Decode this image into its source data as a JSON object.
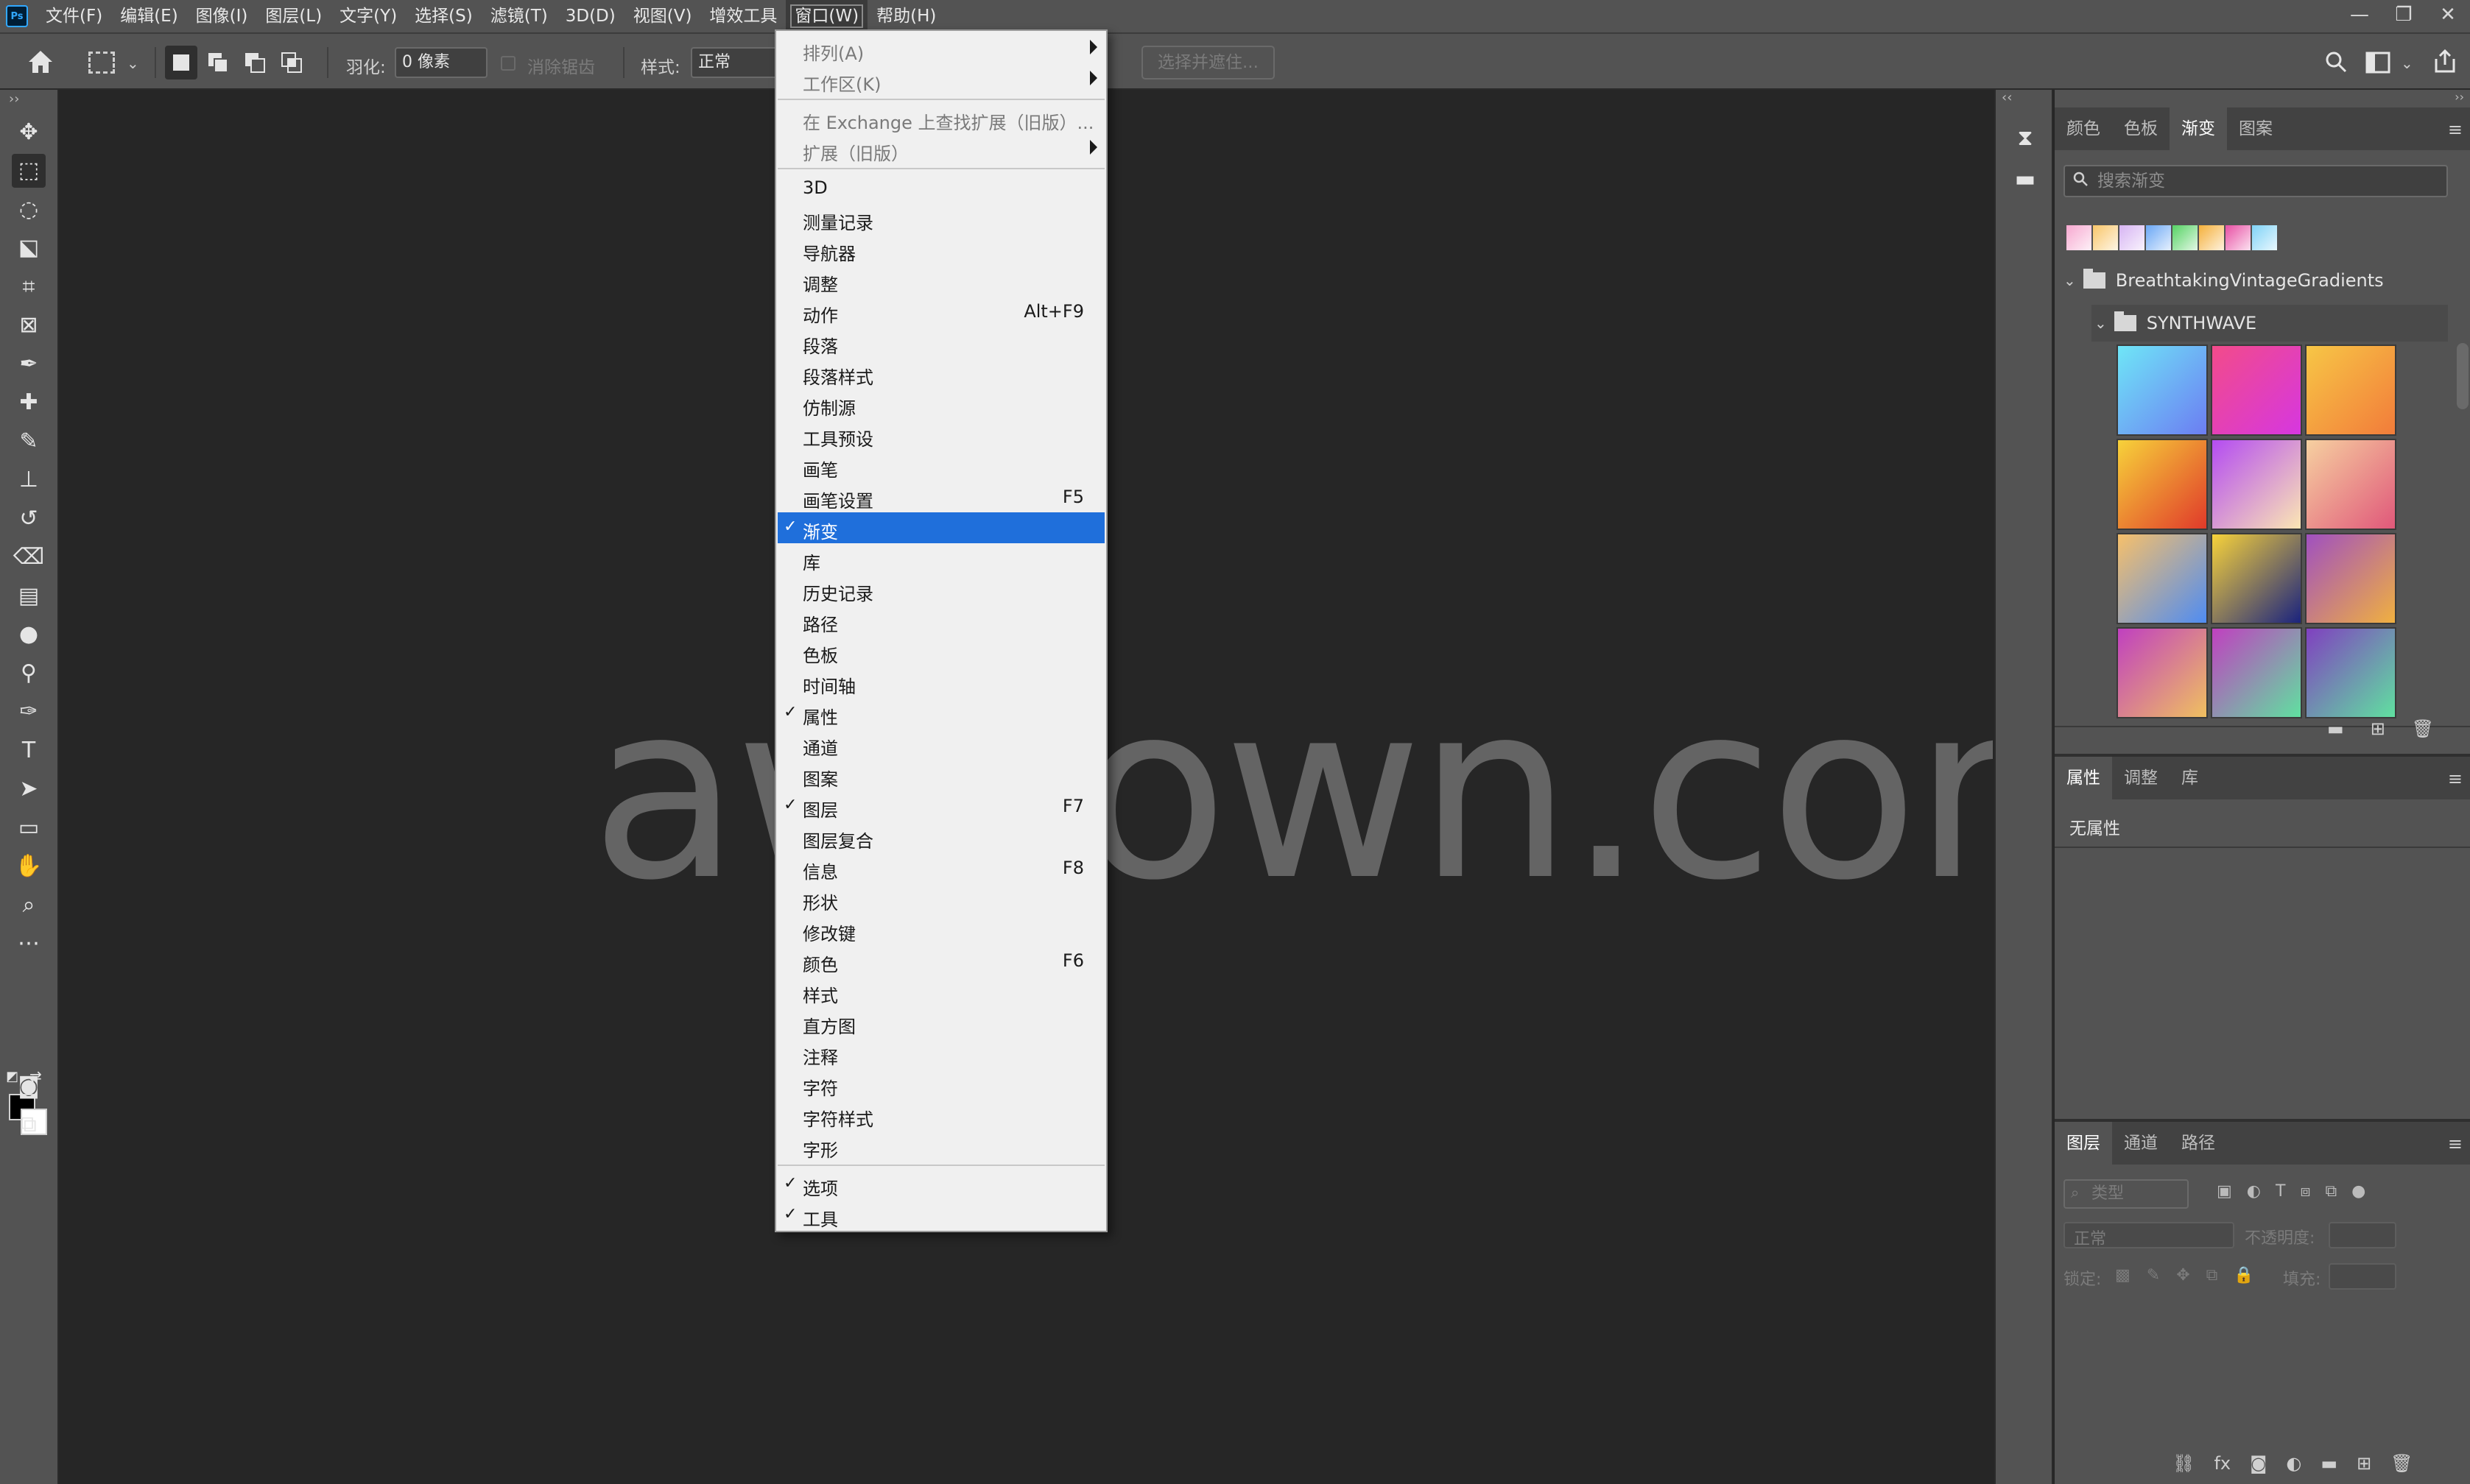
{
  "app": {
    "logo": "Ps"
  },
  "menubar": {
    "items": [
      "文件(F)",
      "编辑(E)",
      "图像(I)",
      "图层(L)",
      "文字(Y)",
      "选择(S)",
      "滤镜(T)",
      "3D(D)",
      "视图(V)",
      "增效工具",
      "窗口(W)",
      "帮助(H)"
    ],
    "active_index": 10,
    "window_controls": [
      "—",
      "❐",
      "✕"
    ]
  },
  "options": {
    "feather_label": "羽化:",
    "feather_value": "0 像素",
    "antialias_label": "消除锯齿",
    "style_label": "样式:",
    "style_value": "正常",
    "select_mask_button": "选择并遮住..."
  },
  "tools": [
    "move-tool",
    "rectangular-marquee-tool",
    "lasso-tool",
    "object-selection-tool",
    "crop-tool",
    "frame-tool",
    "eyedropper-tool",
    "healing-brush-tool",
    "brush-tool",
    "clone-stamp-tool",
    "history-brush-tool",
    "eraser-tool",
    "gradient-tool",
    "blur-tool",
    "dodge-tool",
    "pen-tool",
    "type-tool",
    "path-selection-tool",
    "rectangle-tool",
    "hand-tool",
    "zoom-tool",
    "more-tools"
  ],
  "canvas": {
    "watermark": "awdown.com"
  },
  "window_menu": {
    "groups": [
      [
        {
          "label": "排列(A)",
          "submenu": true,
          "dim": true
        },
        {
          "label": "工作区(K)",
          "submenu": true,
          "dim": true
        }
      ],
      [
        {
          "label": "在 Exchange 上查找扩展（旧版）...",
          "dim": true
        },
        {
          "label": "扩展（旧版）",
          "submenu": true,
          "dim": true
        }
      ],
      [
        {
          "label": "3D"
        },
        {
          "label": "测量记录"
        },
        {
          "label": "导航器"
        },
        {
          "label": "调整"
        },
        {
          "label": "动作",
          "shortcut": "Alt+F9"
        },
        {
          "label": "段落"
        },
        {
          "label": "段落样式"
        },
        {
          "label": "仿制源"
        },
        {
          "label": "工具预设"
        },
        {
          "label": "画笔"
        },
        {
          "label": "画笔设置",
          "shortcut": "F5"
        },
        {
          "label": "渐变",
          "checked": true,
          "highlighted": true
        },
        {
          "label": "库"
        },
        {
          "label": "历史记录"
        },
        {
          "label": "路径"
        },
        {
          "label": "色板"
        },
        {
          "label": "时间轴"
        },
        {
          "label": "属性",
          "checked": true
        },
        {
          "label": "通道"
        },
        {
          "label": "图案"
        },
        {
          "label": "图层",
          "checked": true,
          "shortcut": "F7"
        },
        {
          "label": "图层复合"
        },
        {
          "label": "信息",
          "shortcut": "F8"
        },
        {
          "label": "形状"
        },
        {
          "label": "修改键"
        },
        {
          "label": "颜色",
          "shortcut": "F6"
        },
        {
          "label": "样式"
        },
        {
          "label": "直方图"
        },
        {
          "label": "注释"
        },
        {
          "label": "字符"
        },
        {
          "label": "字符样式"
        },
        {
          "label": "字形"
        }
      ],
      [
        {
          "label": "选项",
          "checked": true
        },
        {
          "label": "工具",
          "checked": true
        }
      ]
    ]
  },
  "gradients_panel": {
    "tabs": [
      "颜色",
      "色板",
      "渐变",
      "图案"
    ],
    "active_tab": 2,
    "search_placeholder": "搜索渐变",
    "swatches": [
      "#f7a8d0",
      "#f9c66a",
      "#d7b4f3",
      "#6aa7f5",
      "#56d364",
      "#f5b03a",
      "#e84fa4",
      "#7fd3f7"
    ],
    "root_folder": "BreathtakingVintageGradients",
    "sub_folder": "SYNTHWAVE",
    "grid_gradients": [
      [
        "#6fe6f7",
        "#6c7df2"
      ],
      [
        "#f24b8a",
        "#d637e0"
      ],
      [
        "#f7c646",
        "#f27c3a"
      ],
      [
        "#f7d23a",
        "#e03a2a"
      ],
      [
        "#b44cf2",
        "#fbe6b4"
      ],
      [
        "#f6d0a0",
        "#e0587a"
      ],
      [
        "#f7c06a",
        "#4f8cf2"
      ],
      [
        "#f7d23a",
        "#1a237e"
      ],
      [
        "#a050c0",
        "#f0b040"
      ],
      [
        "#c040c0",
        "#f0c060"
      ],
      [
        "#c040c0",
        "#60e0a0"
      ],
      [
        "#8040c0",
        "#60e0a0"
      ]
    ]
  },
  "properties_panel": {
    "tabs": [
      "属性",
      "调整",
      "库"
    ],
    "active_tab": 0,
    "empty_text": "无属性"
  },
  "layers_panel": {
    "tabs": [
      "图层",
      "通道",
      "路径"
    ],
    "active_tab": 0,
    "filter_label": "类型",
    "blend_mode": "正常",
    "opacity_label": "不透明度:",
    "lock_label": "锁定:",
    "fill_label": "填充:"
  }
}
